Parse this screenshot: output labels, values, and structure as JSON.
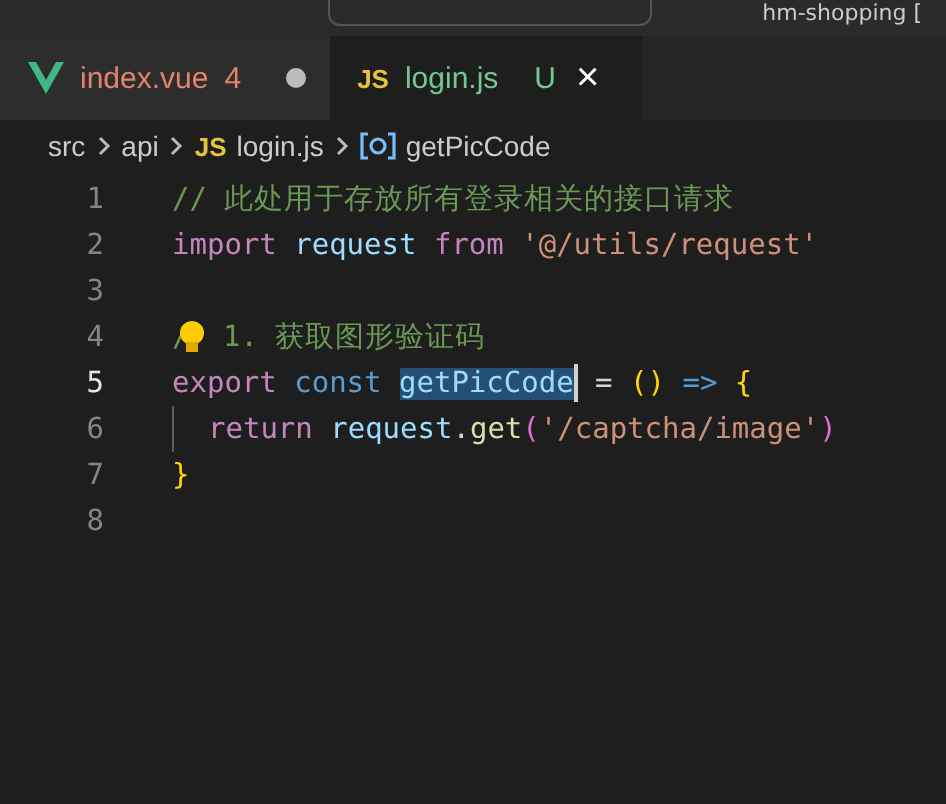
{
  "title_bar": {
    "title": "hm-shopping ["
  },
  "tabs": [
    {
      "label": "index.vue",
      "kind": "vue",
      "problems": "4",
      "modified": true,
      "selected": false
    },
    {
      "label": "login.js",
      "kind": "js",
      "icon_text": "JS",
      "git_status": "U",
      "close": "×",
      "selected": true
    }
  ],
  "breadcrumb": [
    {
      "kind": "folder",
      "label": "src"
    },
    {
      "kind": "folder",
      "label": "api"
    },
    {
      "kind": "file",
      "icon_text": "JS",
      "label": "login.js"
    },
    {
      "kind": "symbol",
      "label": "getPicCode"
    }
  ],
  "editor": {
    "lines": [
      {
        "number": "1",
        "active": false,
        "tokens": [
          {
            "kind": "comment",
            "text": "// 此处用于存放所有登录相关的接口请求"
          }
        ]
      },
      {
        "number": "2",
        "active": false,
        "tokens": [
          {
            "kind": "keyword",
            "text": "import"
          },
          {
            "kind": "variable",
            "text": " request"
          },
          {
            "kind": "keyword",
            "text": " from"
          },
          {
            "kind": "string",
            "text": " '@/utils/request'"
          }
        ]
      },
      {
        "number": "3",
        "active": false
      },
      {
        "number": "4",
        "active": false,
        "tokens": [
          {
            "kind": "comment",
            "text": "/"
          },
          {
            "kind": "bulb"
          },
          {
            "kind": "comment",
            "text": " 1. 获取图形验证码"
          }
        ]
      },
      {
        "number": "5",
        "active": true,
        "tokens": [
          {
            "kind": "keyword",
            "text": "export"
          },
          {
            "kind": "storage",
            "text": " const "
          },
          {
            "kind": "selection",
            "text": "getPicCode"
          },
          {
            "kind": "cursor"
          },
          {
            "kind": "plain",
            "text": " ="
          },
          {
            "kind": "bracket",
            "text": " ()"
          },
          {
            "kind": "storage",
            "text": " =>"
          },
          {
            "kind": "bracket",
            "text": " {"
          }
        ]
      },
      {
        "number": "6",
        "active": false,
        "tokens": [
          {
            "kind": "guide"
          },
          {
            "kind": "keyword",
            "text": "return"
          },
          {
            "kind": "variable",
            "text": " request"
          },
          {
            "kind": "plain",
            "text": "."
          },
          {
            "kind": "function",
            "text": "get"
          },
          {
            "kind": "paren",
            "text": "("
          },
          {
            "kind": "string",
            "text": "'/captcha/image'"
          },
          {
            "kind": "paren",
            "text": ")"
          }
        ]
      },
      {
        "number": "7",
        "active": false,
        "tokens": [
          {
            "kind": "bracket",
            "text": "}"
          }
        ]
      },
      {
        "number": "8",
        "active": false
      }
    ]
  }
}
